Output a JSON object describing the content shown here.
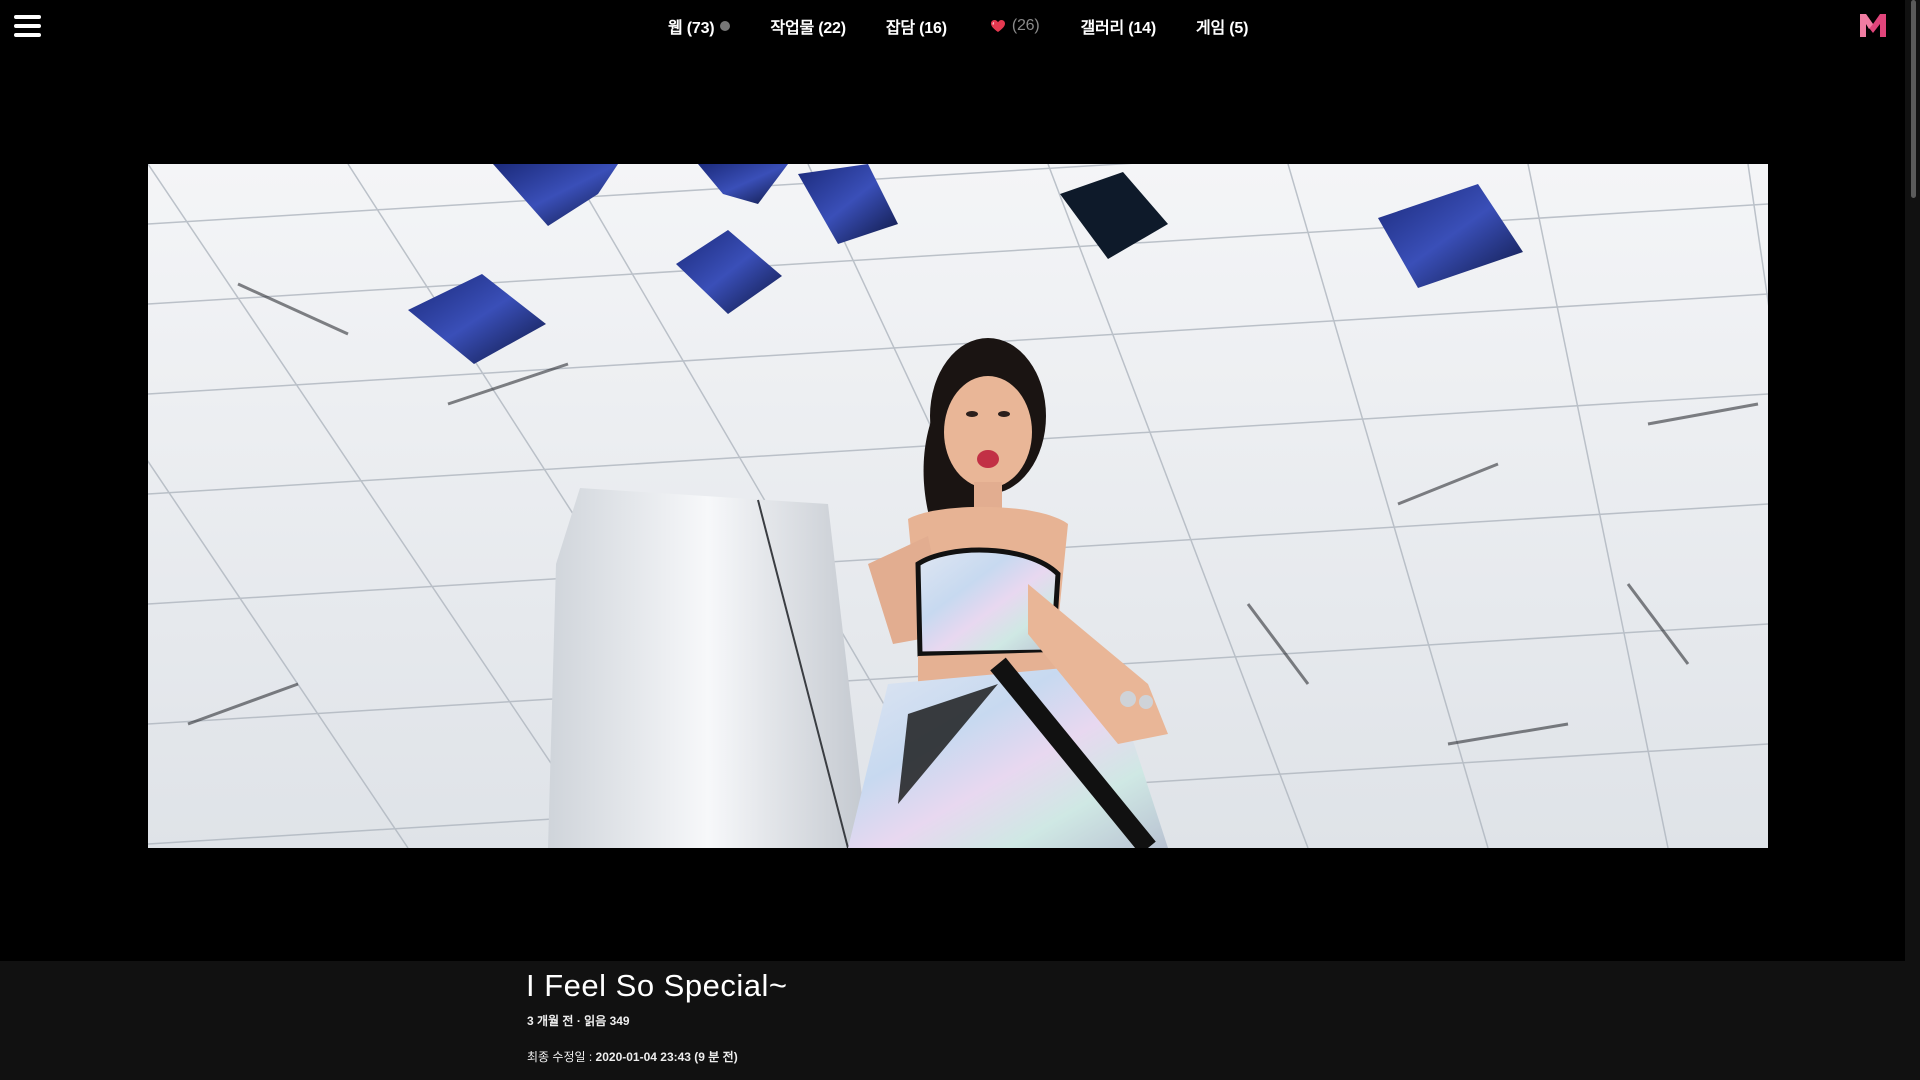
{
  "nav": {
    "items": [
      {
        "label": "웹 (73)",
        "has_dot": true
      },
      {
        "label": "작업물 (22)"
      },
      {
        "label": "잡담 (16)"
      },
      {
        "label": "(26)",
        "icon": "heart-icon",
        "muted": true
      },
      {
        "label": "갤러리 (14)"
      },
      {
        "label": "게임 (5)"
      }
    ]
  },
  "post": {
    "title": "I Feel So Special~",
    "meta": {
      "age": "3 개월 전",
      "separator": "·",
      "reads": "읽음 349"
    },
    "updated_label": "최종 수정일 : ",
    "updated_value": "2020-01-04 23:43 (9 분 전)"
  },
  "colors": {
    "background": "#000000",
    "info_bar": "#111111",
    "logo_pink": "#e0457b",
    "heart_red": "#e53950"
  },
  "icons": [
    "menu-icon",
    "heart-icon",
    "logo-icon"
  ]
}
